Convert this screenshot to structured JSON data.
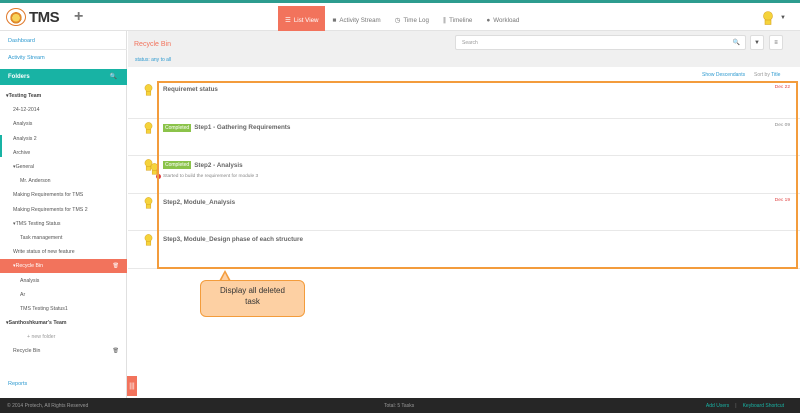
{
  "app": {
    "name": "TMS"
  },
  "nav": {
    "tabs": [
      {
        "label": "List View",
        "icon": "list-icon",
        "active": true
      },
      {
        "label": "Activity Stream",
        "icon": "chat-icon"
      },
      {
        "label": "Time Log",
        "icon": "clock-icon"
      },
      {
        "label": "Timeline",
        "icon": "bars-icon"
      },
      {
        "label": "Workload",
        "icon": "user-icon"
      }
    ]
  },
  "sidebar": {
    "dashboard": "Dashboard",
    "activity_stream": "Activity Stream",
    "folders": "Folders",
    "reports": "Reports",
    "tree": [
      {
        "label": "Testing Team",
        "type": "team",
        "indent": 0,
        "caret": true
      },
      {
        "label": "24-12-2014",
        "indent": 1
      },
      {
        "label": "Analysis",
        "indent": 1
      },
      {
        "label": "Analysis 2",
        "indent": 1
      },
      {
        "label": "Archive",
        "indent": 1
      },
      {
        "label": "General",
        "indent": 1,
        "caret": true
      },
      {
        "label": "Mr. Anderson",
        "indent": 2
      },
      {
        "label": "Making Requirements for TMS",
        "indent": 1
      },
      {
        "label": "Making Requirements for TMS 2",
        "indent": 1
      },
      {
        "label": "TMS Testing Status",
        "indent": 1,
        "caret": true
      },
      {
        "label": "Task management",
        "indent": 2
      },
      {
        "label": "Write status of new feature",
        "indent": 1
      },
      {
        "label": "Recycle Bin",
        "indent": 1,
        "caret": true,
        "selected": true,
        "trash": true
      },
      {
        "label": "Analysis",
        "indent": 2
      },
      {
        "label": "Ar",
        "indent": 2
      },
      {
        "label": "TMS Testing Status1",
        "indent": 2
      },
      {
        "label": "Santhoshkumar's Team",
        "type": "team",
        "indent": 0,
        "caret": true
      },
      {
        "label": "+ new folder",
        "indent": 3,
        "muted": true
      },
      {
        "label": "Recycle Bin",
        "indent": 1,
        "trash": true
      }
    ]
  },
  "main": {
    "title": "Recycle Bin",
    "status_prefix": "status: any",
    "status_value": "to all",
    "search_placeholder": "Search",
    "show_descendants": "Show Descendants",
    "sort_by_label": "Sort by",
    "sort_by_value": "Title",
    "tasks": [
      {
        "badge": "",
        "title": "Requiremet status",
        "sub": "",
        "date": "Dec 22",
        "date_red": true
      },
      {
        "badge": "Completed",
        "title": "Step1 - Gathering Requirements",
        "sub": "",
        "date": "Dec 09",
        "date_red": false
      },
      {
        "badge": "Completed",
        "title": "Step2 - Analysis",
        "sub": "Started to build the requirement for module 3",
        "date": "",
        "date_red": false
      },
      {
        "badge": "",
        "title": "Step2, Module_Analysis",
        "sub": "",
        "date": "Dec 19",
        "date_red": true
      },
      {
        "badge": "",
        "title": "Step3, Module_Design phase of each structure",
        "sub": "",
        "date": "",
        "date_red": false
      }
    ]
  },
  "callout": {
    "line1": "Display all deleted",
    "line2": "task"
  },
  "footer": {
    "copyright": "© 2014 Protech, All Rights Reserved",
    "total": "Total: 5 Tasks",
    "add_users": "Add Users",
    "keyboard_shortcut": "Keyboard Shortcut"
  },
  "colors": {
    "accent": "#f2735c",
    "teal": "#18b3a4",
    "highlight": "#f39c3c",
    "badge": "#8bc34a"
  }
}
